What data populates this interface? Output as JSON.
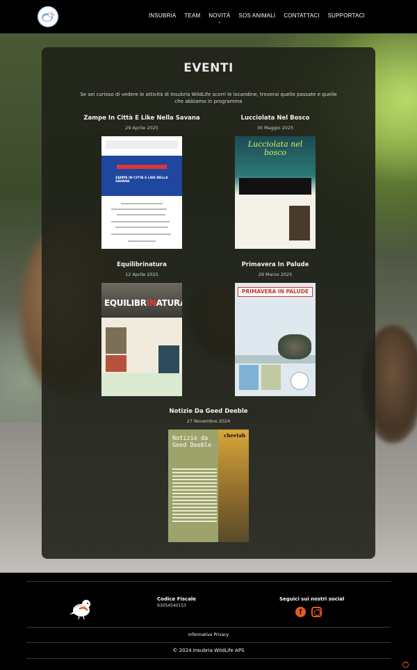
{
  "nav": {
    "items": [
      {
        "label": "INSUBRIA"
      },
      {
        "label": "TEAM"
      },
      {
        "label": "NOVITÀ"
      },
      {
        "label": "SOS ANIMALI"
      },
      {
        "label": "CONTATTACI"
      },
      {
        "label": "SUPPORTACI"
      }
    ],
    "dropdown_icon": "chevron-down-icon"
  },
  "events": {
    "title": "EVENTI",
    "intro": "Se sei curioso di vedere le attività di Insubria WildLife scorri le locandine, troverai quelle passate e quelle che abbiamo in programma",
    "items": [
      {
        "title": "Zampe In Città E Like Nella Savana",
        "date": "29 Aprile 2025"
      },
      {
        "title": "Lucciolata Nel Bosco",
        "date": "30 Maggio 2025"
      },
      {
        "title": "Equilibrinatura",
        "date": "12 Aprile 2025"
      },
      {
        "title": "Primavera In Palude",
        "date": "29 Marzo 2025"
      },
      {
        "title": "Notizie Da Geed Deeble",
        "date": "27 Novembre 2024"
      }
    ],
    "posters": {
      "p1_text": "ZAMPE IN CITTÀ E LIKE NELLA SAVANA",
      "p2_title": "Lucciolata nel bosco",
      "p3_title_a": "EQUILIBR",
      "p3_title_b": "IN",
      "p3_title_c": "ATURA",
      "p4_title": "PRIMAVERA IN PALUDE",
      "p5_title": "Notizie da Geed Deeble",
      "p5_label": "cheetah"
    }
  },
  "footer": {
    "fiscal_code_label": "Codice Fiscale",
    "fiscal_code_value": "93054540153",
    "social_label": "Seguici sui nostri social",
    "privacy": "Informativa Privacy",
    "copyright": "© 2024 Insubria WildLife APS"
  },
  "colors": {
    "accent": "#e65a22",
    "header_bg": "#000000",
    "panel_bg": "#1e2018"
  }
}
